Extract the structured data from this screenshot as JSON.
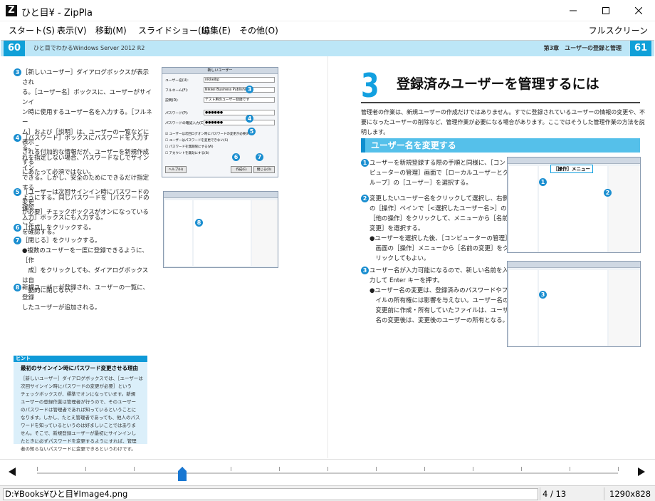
{
  "window": {
    "app_icon_letter": "Z",
    "title": "ひと目¥ - ZipPla",
    "controls": {
      "minimize": "minimize",
      "maximize": "maximize",
      "close": "close"
    }
  },
  "menu": {
    "items": [
      "スタート(S)",
      "表示(V)",
      "移動(M)",
      "スライドショー(L)",
      "編集(E)",
      "その他(O)"
    ],
    "fullscreen": "フルスクリーン"
  },
  "page": {
    "left_page_number": "60",
    "right_page_number": "61",
    "book_title": "ひと目でわかるWindows Server 2012 R2",
    "chapter": "第3章　ユーザーの登録と管理",
    "left_steps": [
      {
        "num": "3",
        "lines": [
          "［新しいユーザー］ダイアログボックスが表示され",
          "る。［ユーザー名］ボックスに、ユーザーがサインイ",
          "ン時に使用するユーザー名を入力する。［フルネー",
          "ム］および［説明］は、ユーザーの一覧などに表示",
          "される付加的な情報だが、ユーザーを新規作成する",
          "にあたって必須ではない。"
        ]
      },
      {
        "num": "4",
        "lines": [
          "［パスワード］ボックスにパスワードを入力する。こ",
          "れを指定しない場合、パスワードなしでサインイン",
          "できる。しかし、安全のためにできるだけ指定する",
          "ようにする。同じパスワードを［パスワードの確認",
          "入力］ボックスにも入力する。"
        ]
      },
      {
        "num": "5",
        "lines": [
          "［ユーザーは次回サインイン時にパスワードの変更",
          "が必要］チェックボックスがオンになっていること",
          "を確認する。"
        ]
      },
      {
        "num": "6",
        "lines": [
          "［作成］をクリックする。"
        ]
      },
      {
        "num": "7",
        "lines": [
          "［閉じる］をクリックする。",
          "●複数のユーザーを一度に登録できるように、［作",
          "　成］をクリックしても、ダイアログボックスは自",
          "　動的に閉じない。"
        ]
      },
      {
        "num": "8",
        "lines": [
          "新規ユーザーが登録され、ユーザーの一覧に、登録",
          "したユーザーが追加される。"
        ]
      }
    ],
    "dialog": {
      "title": "新しいユーザー",
      "fields": [
        {
          "label": "ユーザー名(U):",
          "value": "nikkeibp"
        },
        {
          "label": "フルネーム(F):",
          "value": "Nikkei Business Publishing"
        },
        {
          "label": "説明(D):",
          "value": "テスト用のユーザー登録です"
        },
        {
          "label": "パスワード(P):",
          "value": "●●●●●●"
        },
        {
          "label": "パスワードの確認入力(C):",
          "value": "●●●●●●"
        }
      ],
      "checkboxes": [
        "ユーザーは次回ログオン時にパスワードの変更が必要(M)",
        "ユーザーはパスワードを変更できない(S)",
        "パスワードを無期限にする(W)",
        "アカウントを無効にする(B)"
      ],
      "buttons": [
        "ヘルプ(H)",
        "作成(E)",
        "閉じる(O)"
      ],
      "callouts": [
        "3",
        "4",
        "5",
        "6",
        "7"
      ]
    },
    "users_window_callout": "8",
    "hint": {
      "tag": "ヒント",
      "title": "最初のサインイン時にパスワード変更させる理由",
      "lines": [
        "［新しいユーザー］ダイアログボックスでは、［ユーザーは",
        "次回サインイン時にパスワードの変更が必要］という",
        "チェックボックスが、標準でオンになっています。新規",
        "ユーザーの登録作業は管理者が行うので、そのユーザー",
        "のパスワードは管理者であれば知っているということに",
        "なります。しかし、たとえ管理者であっても、他人のパス",
        "ワードを知っているというのは好ましいことではありま",
        "せん。そこで、新規登録ユーザーが最初にサインインし",
        "たときに必ずパスワードを変更するようにすれば、管理",
        "者の知らないパスワードに変更できるというわけです。"
      ]
    },
    "section": {
      "number": "3",
      "title": "登録済みユーザーを管理するには",
      "intro": [
        "管理者の作業は、新規ユーザーの作成だけではありません。すでに登録されているユーザーの情報の変更や、不",
        "要になったユーザーの削除など、管理作業が必要になる場合があります。ここではそうした管理作業の方法を説",
        "明します。"
      ],
      "subheading": "ユーザー名を変更する"
    },
    "right_steps": [
      {
        "num": "1",
        "lines": [
          "ユーザーを新規登録する際の手順と同様に、［コン",
          "ピューターの管理］画面で［ローカルユーザーとグ",
          "ループ］の［ユーザー］を選択する。"
        ]
      },
      {
        "num": "2",
        "lines": [
          "変更したいユーザー名をクリックして選択し、右側",
          "の［操作］ペインで［<選択したユーザー名>］の",
          "［他の操作］をクリックして、メニューから［名前の",
          "変更］を選択する。",
          "●ユーザーを選択した後、［コンピューターの管理］",
          "　画面の［操作］メニューから［名前の変更］をク",
          "　リックしてもよい。"
        ]
      },
      {
        "num": "3",
        "lines": [
          "ユーザー名が入力可能になるので、新しい名前を入",
          "力して Enter キーを押す。",
          "●ユーザー名の変更は、登録済みのパスワードやファ",
          "　イルの所有権には影響を与えない。ユーザー名の",
          "　変更前に作成・所有していたファイルは、ユーザー",
          "　名の変更後は、変更後のユーザーの所有となる。"
        ]
      }
    ],
    "shot1_menu_label": "［操作］メニュー",
    "shot1_callouts": [
      "1",
      "2"
    ],
    "shot2_callout": "3"
  },
  "navigation": {
    "prev": "previous-page",
    "next": "next-page",
    "progress": 0.25
  },
  "status": {
    "path": "D:¥Books¥ひと目¥Image4.png",
    "page": "4 / 13",
    "size": "1290x828"
  },
  "colors": {
    "accent": "#12a0e0",
    "header_band": "#bce6f7",
    "hint_bg": "#dbeffa"
  }
}
